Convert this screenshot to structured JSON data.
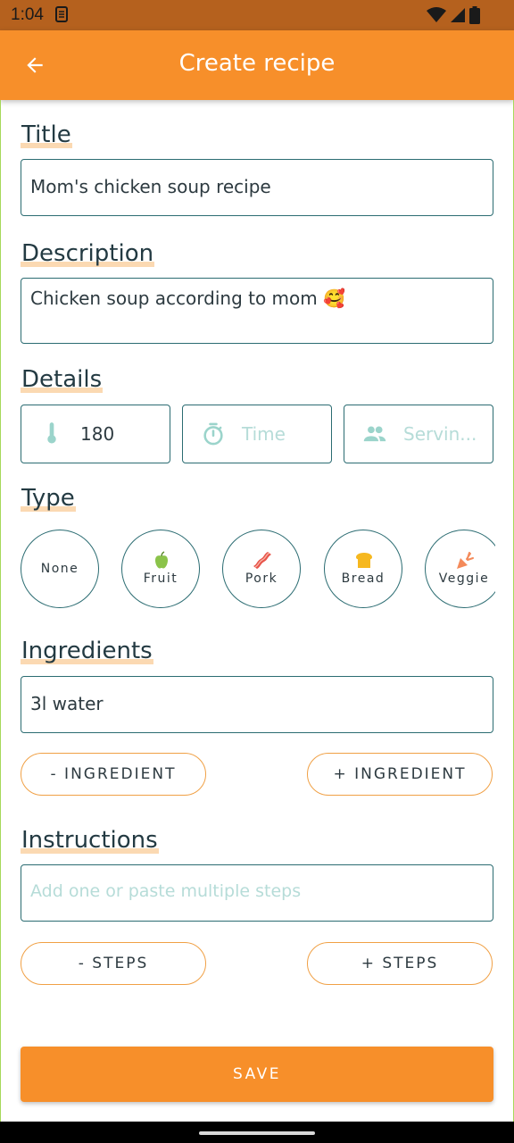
{
  "status_bar": {
    "time": "1:04"
  },
  "app_bar": {
    "title": "Create recipe"
  },
  "title_section": {
    "label": "Title",
    "value": "Mom's chicken soup recipe"
  },
  "description_section": {
    "label": "Description",
    "value": "Chicken soup according to mom 🥰"
  },
  "details_section": {
    "label": "Details",
    "temperature": {
      "icon": "thermometer-icon",
      "value": "180"
    },
    "time": {
      "icon": "timer-icon",
      "placeholder": "Time"
    },
    "servings": {
      "icon": "people-icon",
      "placeholder": "Servin..."
    }
  },
  "type_section": {
    "label": "Type",
    "options": [
      {
        "label": "None",
        "icon": ""
      },
      {
        "label": "Fruit",
        "icon": "apple-icon"
      },
      {
        "label": "Pork",
        "icon": "bacon-icon"
      },
      {
        "label": "Bread",
        "icon": "bread-icon"
      },
      {
        "label": "Veggie",
        "icon": "carrot-icon"
      }
    ]
  },
  "ingredients_section": {
    "label": "Ingredients",
    "value": "3l water",
    "remove_label": "- INGREDIENT",
    "add_label": "+ INGREDIENT"
  },
  "instructions_section": {
    "label": "Instructions",
    "placeholder": "Add one or paste multiple steps",
    "remove_label": "- STEPS",
    "add_label": "+ STEPS"
  },
  "save_label": "SAVE",
  "colors": {
    "accent": "#f78f2a",
    "status_bar": "#b5611e",
    "field_border": "#2b6c72",
    "placeholder": "#b6dcd8",
    "label_highlight": "#fbd9b2",
    "outline_button": "#f0a045"
  }
}
